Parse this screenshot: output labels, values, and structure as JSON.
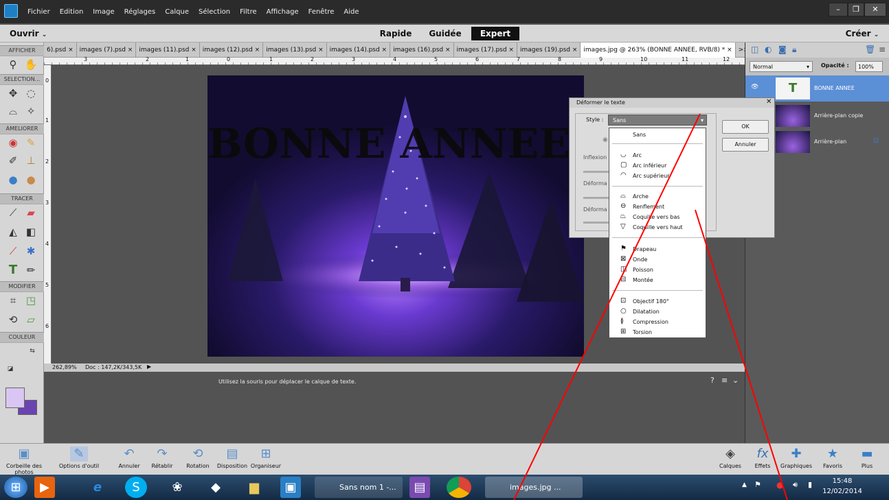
{
  "menubar": {
    "items": [
      "Fichier",
      "Edition",
      "Image",
      "Réglages",
      "Calque",
      "Sélection",
      "Filtre",
      "Affichage",
      "Fenêtre",
      "Aide"
    ]
  },
  "modebar": {
    "open_label": "Ouvrir",
    "modes": [
      "Rapide",
      "Guidée",
      "Expert"
    ],
    "create_label": "Créer"
  },
  "tools": {
    "sections": [
      "AFFICHER",
      "SELECTION...",
      "AMELIORER",
      "TRACER",
      "MODIFIER",
      "COULEUR"
    ]
  },
  "tabs": [
    "6).psd ×",
    "images (7).psd ×",
    "images (11).psd ×",
    "images (12).psd ×",
    "images (13).psd ×",
    "images (14).psd ×",
    "images (16).psd ×",
    "images (17).psd ×",
    "images (19).psd ×",
    "images.jpg @ 263% (BONNE ANNEE, RVB/8) * ×",
    ">>"
  ],
  "ruler_marks": [
    "3",
    "2",
    "1",
    "0",
    "1",
    "2",
    "3",
    "4",
    "5",
    "6",
    "7",
    "8",
    "9",
    "10",
    "11",
    "12"
  ],
  "ruler_v_marks": [
    "0",
    "1",
    "2",
    "3",
    "4",
    "5",
    "6"
  ],
  "canvas": {
    "text": "BONNE ANNEE"
  },
  "status": {
    "zoom": "262,89%",
    "doc": "Doc : 147,2K/343,5K",
    "hint": "Utilisez la souris pour déplacer le calque de texte."
  },
  "layers": {
    "blend_mode": "Normal",
    "opacity_label": "Opacité :",
    "opacity_value": "100%",
    "items": [
      {
        "name": "BONNE ANNEE",
        "selected": true
      },
      {
        "name": "Arrière-plan copie",
        "selected": false
      },
      {
        "name": "Arrière-plan",
        "selected": false
      }
    ]
  },
  "dialog": {
    "title": "Déformer le texte",
    "style_label": "Style :",
    "style_value": "Sans",
    "ok": "OK",
    "cancel": "Annuler",
    "inflexion_label": "Inflexion",
    "deform_label_1": "Déforma",
    "deform_label_2": "Déforma"
  },
  "dropdown": {
    "items": [
      {
        "label": "Sans",
        "icon": ""
      },
      {
        "label": "Arc",
        "icon": "arc-icon"
      },
      {
        "label": "Arc inférieur",
        "icon": "arc-lower-icon"
      },
      {
        "label": "Arc supérieur",
        "icon": "arc-upper-icon"
      },
      {
        "label": "Arche",
        "icon": "arch-icon"
      },
      {
        "label": "Renflement",
        "icon": "bulge-icon"
      },
      {
        "label": "Coquille vers bas",
        "icon": "shell-lower-icon"
      },
      {
        "label": "Coquille vers haut",
        "icon": "shell-upper-icon"
      },
      {
        "label": "Drapeau",
        "icon": "flag-icon"
      },
      {
        "label": "Onde",
        "icon": "wave-icon"
      },
      {
        "label": "Poisson",
        "icon": "fish-icon"
      },
      {
        "label": "Montée",
        "icon": "rise-icon"
      },
      {
        "label": "Objectif 180°",
        "icon": "fisheye-icon"
      },
      {
        "label": "Dilatation",
        "icon": "inflate-icon"
      },
      {
        "label": "Compression",
        "icon": "squeeze-icon"
      },
      {
        "label": "Torsion",
        "icon": "twist-icon"
      }
    ]
  },
  "bottombar": {
    "left": [
      "Corbeille des photos",
      "Options d'outil",
      "Annuler",
      "Rétablir",
      "Rotation",
      "Disposition",
      "Organiseur"
    ],
    "right": [
      "Calques",
      "Effets",
      "Graphiques",
      "Favoris",
      "Plus"
    ]
  },
  "taskbar": {
    "apps": [
      "Sans nom 1 -...",
      "images.jpg ..."
    ],
    "time": "15:48",
    "date": "12/02/2014"
  },
  "colors": {
    "selected_layer": "#5b8fd6",
    "foreground": "#d9c6f2",
    "background": "#6a44b0",
    "annotation_line": "#ff0000"
  }
}
